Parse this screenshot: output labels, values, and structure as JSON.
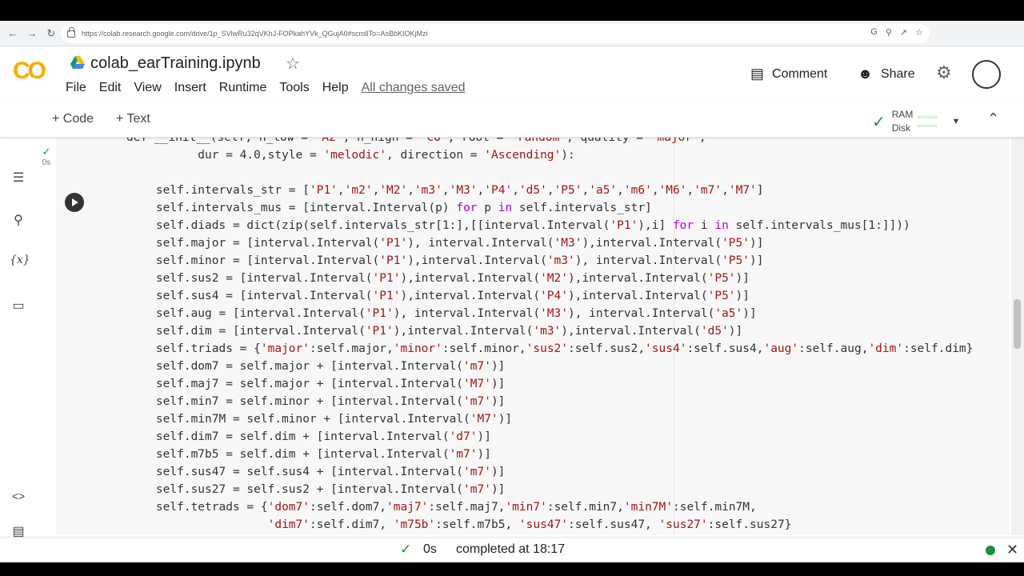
{
  "browser": {
    "url": "https://colab.research.google.com/drive/1p_SVlwRu32qVKhJ-FOPkahYVk_QGujA0#scrollTo=AsBbKIOKjMzi"
  },
  "header": {
    "logo": "CO",
    "notebook_title": "colab_earTraining.ipynb",
    "menu": [
      "File",
      "Edit",
      "View",
      "Insert",
      "Runtime",
      "Tools",
      "Help"
    ],
    "save_status": "All changes saved",
    "comment_label": "Comment",
    "share_label": "Share"
  },
  "toolbar": {
    "code_label": "+ Code",
    "text_label": "+ Text",
    "ram_label": "RAM",
    "disk_label": "Disk"
  },
  "cell": {
    "status_time": "0s",
    "lines": [
      {
        "indent": 0,
        "text": "def __init__(self, n_low = 'A2', n_high = 'C6', root = 'random', quality = 'major',"
      },
      {
        "indent": 1,
        "text": "          dur = 4.0,style = 'melodic', direction = 'Ascending'):"
      },
      {
        "indent": 0,
        "text": ""
      },
      {
        "indent": 0,
        "text": "    self.intervals_str = ['P1','m2','M2','m3','M3','P4','d5','P5','a5','m6','M6','m7','M7']"
      },
      {
        "indent": 0,
        "text": "    self.intervals_mus = [interval.Interval(p) for p in self.intervals_str]"
      },
      {
        "indent": 0,
        "text": "    self.diads = dict(zip(self.intervals_str[1:],[[interval.Interval('P1'),i] for i in self.intervals_mus[1:]]))"
      },
      {
        "indent": 0,
        "text": "    self.major = [interval.Interval('P1'), interval.Interval('M3'),interval.Interval('P5')]"
      },
      {
        "indent": 0,
        "text": "    self.minor = [interval.Interval('P1'),interval.Interval('m3'), interval.Interval('P5')]"
      },
      {
        "indent": 0,
        "text": "    self.sus2 = [interval.Interval('P1'),interval.Interval('M2'),interval.Interval('P5')]"
      },
      {
        "indent": 0,
        "text": "    self.sus4 = [interval.Interval('P1'),interval.Interval('P4'),interval.Interval('P5')]"
      },
      {
        "indent": 0,
        "text": "    self.aug = [interval.Interval('P1'), interval.Interval('M3'), interval.Interval('a5')]"
      },
      {
        "indent": 0,
        "text": "    self.dim = [interval.Interval('P1'),interval.Interval('m3'),interval.Interval('d5')]"
      },
      {
        "indent": 0,
        "text": "    self.triads = {'major':self.major,'minor':self.minor,'sus2':self.sus2,'sus4':self.sus4,'aug':self.aug,'dim':self.dim}"
      },
      {
        "indent": 0,
        "text": "    self.dom7 = self.major + [interval.Interval('m7')]"
      },
      {
        "indent": 0,
        "text": "    self.maj7 = self.major + [interval.Interval('M7')]"
      },
      {
        "indent": 0,
        "text": "    self.min7 = self.minor + [interval.Interval('m7')]"
      },
      {
        "indent": 0,
        "text": "    self.min7M = self.minor + [interval.Interval('M7')]"
      },
      {
        "indent": 0,
        "text": "    self.dim7 = self.dim + [interval.Interval('d7')]"
      },
      {
        "indent": 0,
        "text": "    self.m7b5 = self.dim + [interval.Interval('m7')]"
      },
      {
        "indent": 0,
        "text": "    self.sus47 = self.sus4 + [interval.Interval('m7')]"
      },
      {
        "indent": 0,
        "text": "    self.sus27 = self.sus2 + [interval.Interval('m7')]"
      },
      {
        "indent": 0,
        "text": "    self.tetrads = {'dom7':self.dom7,'maj7':self.maj7,'min7':self.min7,'min7M':self.min7M,"
      },
      {
        "indent": 0,
        "text": "                    'dim7':self.dim7, 'm75b':self.m7b5, 'sus47':self.sus47, 'sus27':self.sus27}"
      }
    ]
  },
  "statusbar": {
    "duration": "0s",
    "completed": "completed at 18:17"
  },
  "colors": {
    "logo": "#f9ab00",
    "string": "#a31515",
    "keyword": "#af00db",
    "ok": "#1e8e3e"
  }
}
